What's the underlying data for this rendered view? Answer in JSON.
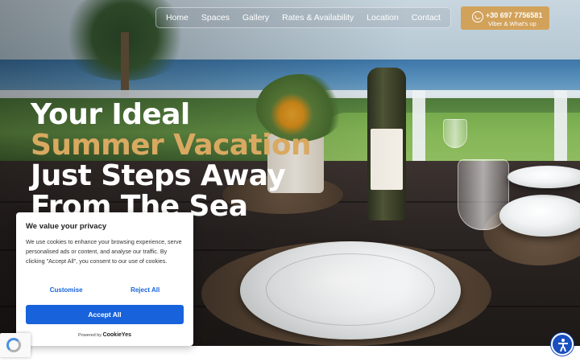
{
  "nav": {
    "items": [
      {
        "label": "Home",
        "active": true
      },
      {
        "label": "Spaces",
        "active": false
      },
      {
        "label": "Gallery",
        "active": false
      },
      {
        "label": "Rates & Availability",
        "active": false
      },
      {
        "label": "Location",
        "active": false
      },
      {
        "label": "Contact",
        "active": false
      }
    ]
  },
  "cta": {
    "phone": "+30 697 7756581",
    "subtitle": "Viber & What's up",
    "icon": "whatsapp-phone-icon",
    "color": "#d2a25b"
  },
  "hero": {
    "line1": "Your Ideal",
    "line2": "Summer Vacation",
    "line3": "Just Steps Away",
    "line4": "From The Sea",
    "accent_color": "#d9a961"
  },
  "cookie": {
    "title": "We value your privacy",
    "text": "We use cookies to enhance your browsing experience, serve personalised ads or content, and analyse our traffic. By clicking \"Accept All\", you consent to our use of cookies.",
    "customise_label": "Customise",
    "reject_label": "Reject All",
    "accept_label": "Accept All",
    "powered_by": "Powered by",
    "brand": "CookieYes",
    "button_color": "#1863dc"
  },
  "widgets": {
    "recaptcha_icon": "recaptcha-icon",
    "accessibility_icon": "accessibility-icon"
  }
}
